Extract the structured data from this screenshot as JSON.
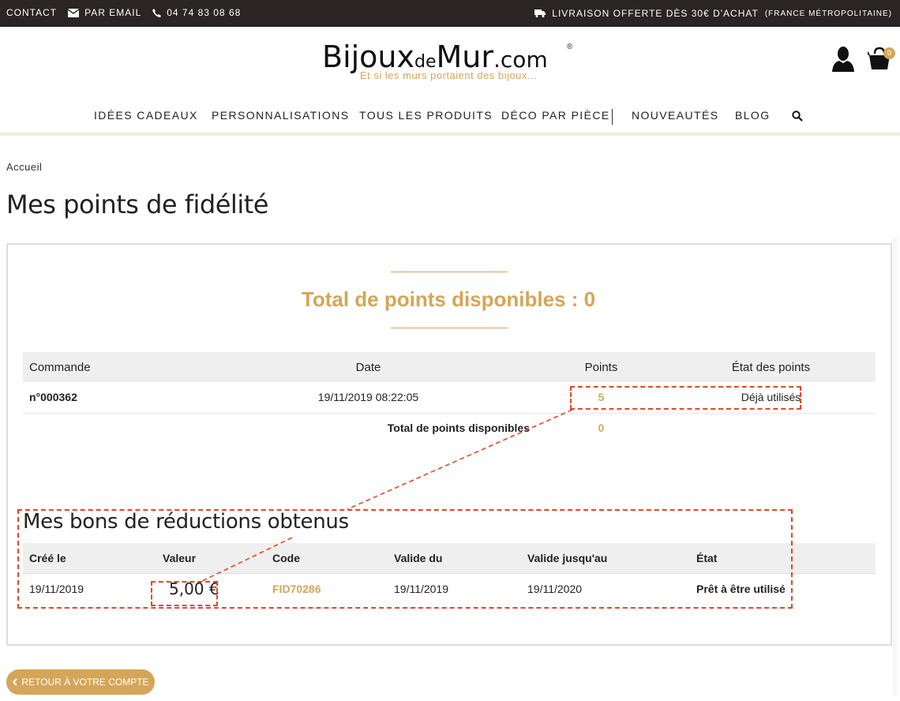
{
  "topbar": {
    "contact": "CONTACT",
    "email": "PAR EMAIL",
    "phone": "04 74 83 08 68",
    "delivery": "LIVRAISON OFFERTE DÈS 30€ D'ACHAT",
    "delivery_note": "(FRANCE MÉTROPOLITAINE)"
  },
  "logo": {
    "part1": "Bijoux",
    "part2": "de",
    "part3": "Mur",
    "part4": ".com",
    "registered": "®",
    "tagline": "Et si les murs portaient des bijoux..."
  },
  "cart": {
    "count": "0"
  },
  "nav": {
    "items": [
      "IDÉES CADEAUX",
      "PERSONNALISATIONS",
      "TOUS LES PRODUITS",
      "DÉCO PAR PIÈCE",
      "NOUVEAUTÉS",
      "BLOG"
    ]
  },
  "breadcrumb": "Accueil",
  "page_title": "Mes points de fidélité",
  "total_heading": "Total de points disponibles : 0",
  "points_table": {
    "headers": [
      "Commande",
      "Date",
      "Points",
      "État des points"
    ],
    "rows": [
      {
        "order": "n°000362",
        "date": "19/11/2019 08:22:05",
        "points": "5",
        "status": "Déjà utilisés"
      }
    ],
    "total_label": "Total de points disponibles",
    "total_value": "0"
  },
  "vouchers": {
    "title": "Mes bons de réductions obtenus",
    "headers": [
      "Créé le",
      "Valeur",
      "Code",
      "Valide du",
      "Valide jusqu'au",
      "État"
    ],
    "rows": [
      {
        "created": "19/11/2019",
        "value": "5,00 €",
        "code": "FID70286",
        "valid_from": "19/11/2019",
        "valid_to": "19/11/2020",
        "state": "Prêt à être utilisé"
      }
    ]
  },
  "back_button": "RETOUR À VOTRE COMPTE",
  "colors": {
    "gold": "#d4a55a",
    "topbar": "#2b2424",
    "annotation": "#e1472b"
  },
  "icons": [
    "envelope-icon",
    "phone-icon",
    "truck-icon",
    "user-icon",
    "cart-icon",
    "search-icon",
    "chevron-left-icon"
  ]
}
